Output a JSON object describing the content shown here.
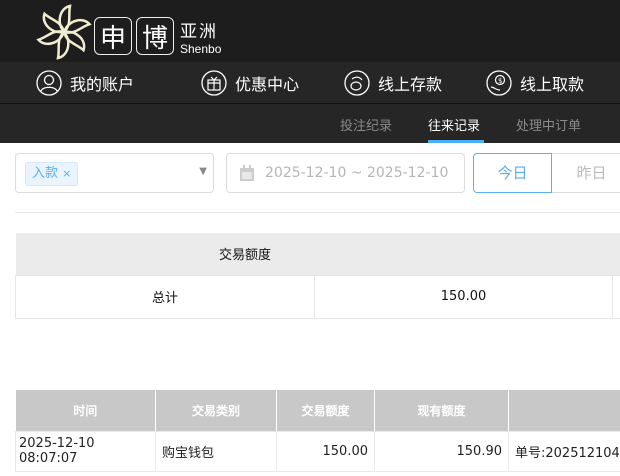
{
  "brand": {
    "char1": "申",
    "char2": "博",
    "name_cn": "亚洲",
    "name_en": "Shenbo"
  },
  "nav": [
    {
      "label": "我的账户",
      "icon": "user-icon"
    },
    {
      "label": "优惠中心",
      "icon": "gift-icon"
    },
    {
      "label": "线上存款",
      "icon": "deposit-icon"
    },
    {
      "label": "线上取款",
      "icon": "withdraw-icon"
    }
  ],
  "subnav": [
    {
      "label": "投注纪录"
    },
    {
      "label": "往来记录",
      "active": true
    },
    {
      "label": "处理中订单"
    }
  ],
  "filters": {
    "type_tag": "入款",
    "type_tag_remove": "×",
    "date_range": "2025-12-10 ~ 2025-12-10",
    "today": "今日",
    "yesterday": "昨日"
  },
  "summary": {
    "header": "交易额度",
    "row_label": "总计",
    "amount": "150.00"
  },
  "details": {
    "columns": [
      "时间",
      "交易类别",
      "交易额度",
      "现有额度",
      ""
    ],
    "rows": [
      {
        "time": "2025-12-10 08:07:07",
        "type": "购宝钱包",
        "amount": "150.00",
        "balance": "150.90",
        "note": "单号:202512104"
      }
    ]
  },
  "colors": {
    "accent": "#4ab0f5",
    "header_bg": "#1d1d1d",
    "nav_bg": "#262626"
  }
}
